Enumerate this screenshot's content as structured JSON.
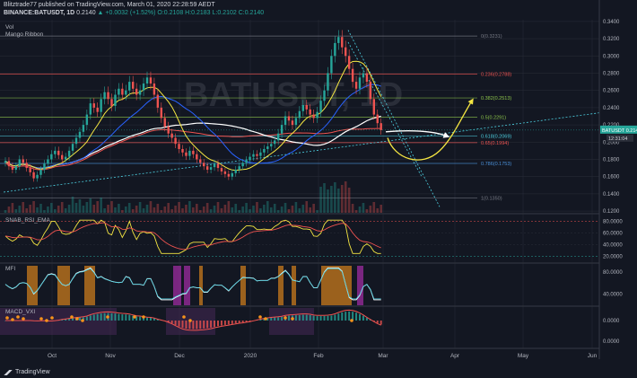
{
  "header": {
    "line1": "Blitztrade77 published on TradingView.com, March 01, 2020 22:28:59 AEDT",
    "symbol": "BINANCE:BATUSDT, 1D",
    "price": "0.2140",
    "change": "▲ +0.0032 (+1.52%)",
    "ohlc": "O:0.2108 H:0.2183 L:0.2102 C:0.2140"
  },
  "indicators": {
    "vol": "Vol",
    "mango": "Mango Ribbon",
    "snab": "SNAB_RSI_EMA",
    "mfi": "MFI",
    "macd": "MACD_VXI"
  },
  "watermark": "BATUSDT, 1D",
  "logo": "TradingView",
  "price_label": {
    "symbol": "BATUSDT",
    "price": "0.2140",
    "countdown": "12:31:04"
  },
  "colors": {
    "bg": "#131722",
    "up": "#26a69a",
    "down": "#ef5350",
    "grid": "#2a2e39",
    "yellow": "#f5e642",
    "white": "#ffffff",
    "blue": "#2962ff",
    "fib_green": "#8bc34a",
    "fib_red": "#ef5350",
    "fib_grey": "#787b86",
    "fib_blue": "#4a90d9",
    "cyan": "#4dd0e1",
    "orange": "#f7931a",
    "magenta": "#c030c0"
  },
  "chart_data": {
    "type": "candlestick",
    "x_ticks": [
      "Oct",
      "Nov",
      "Dec",
      "2020",
      "Feb",
      "Mar",
      "Apr",
      "May",
      "Jun"
    ],
    "price_axis": [
      "0.3400",
      "0.3200",
      "0.3000",
      "0.2800",
      "0.2600",
      "0.2400",
      "0.2200",
      "0.2000",
      "0.1800",
      "0.1600",
      "0.1400",
      "0.1200"
    ],
    "price_range": [
      0.118,
      0.342
    ],
    "fib_levels": [
      {
        "label": "0(0.3231)",
        "value": 0.3231
      },
      {
        "label": "0.236(0.2788)",
        "value": 0.2788
      },
      {
        "label": "0.382(0.2513)",
        "value": 0.2513
      },
      {
        "label": "0.5(0.2291)",
        "value": 0.2291
      },
      {
        "label": "0.618(0.2069)",
        "value": 0.2069
      },
      {
        "label": "0.65(0.1994)",
        "value": 0.1994
      },
      {
        "label": "0.786(0.1753)",
        "value": 0.1753
      },
      {
        "label": "1(0.1350)",
        "value": 0.135
      }
    ],
    "snab_axis": [
      "80.0000",
      "60.0000",
      "40.0000",
      "20.0000"
    ],
    "mfi_axis": [
      "80.0000",
      "40.0000"
    ],
    "macd_axis": [
      "0.0000",
      "0.0000"
    ],
    "closes": [
      0.178,
      0.172,
      0.168,
      0.172,
      0.18,
      0.176,
      0.17,
      0.165,
      0.158,
      0.162,
      0.168,
      0.175,
      0.18,
      0.186,
      0.19,
      0.185,
      0.18,
      0.183,
      0.19,
      0.198,
      0.205,
      0.212,
      0.22,
      0.232,
      0.245,
      0.24,
      0.235,
      0.25,
      0.258,
      0.25,
      0.242,
      0.255,
      0.262,
      0.255,
      0.26,
      0.27,
      0.262,
      0.255,
      0.26,
      0.268,
      0.275,
      0.268,
      0.255,
      0.24,
      0.228,
      0.218,
      0.21,
      0.205,
      0.198,
      0.192,
      0.188,
      0.184,
      0.19,
      0.186,
      0.18,
      0.176,
      0.172,
      0.168,
      0.171,
      0.175,
      0.17,
      0.166,
      0.163,
      0.16,
      0.164,
      0.168,
      0.172,
      0.176,
      0.179,
      0.183,
      0.186,
      0.184,
      0.188,
      0.192,
      0.195,
      0.198,
      0.202,
      0.21,
      0.22,
      0.23,
      0.225,
      0.22,
      0.228,
      0.236,
      0.243,
      0.238,
      0.232,
      0.228,
      0.235,
      0.248,
      0.26,
      0.28,
      0.3,
      0.315,
      0.322,
      0.31,
      0.3,
      0.285,
      0.27,
      0.262,
      0.275,
      0.28,
      0.27,
      0.25,
      0.232,
      0.222,
      0.214
    ]
  }
}
